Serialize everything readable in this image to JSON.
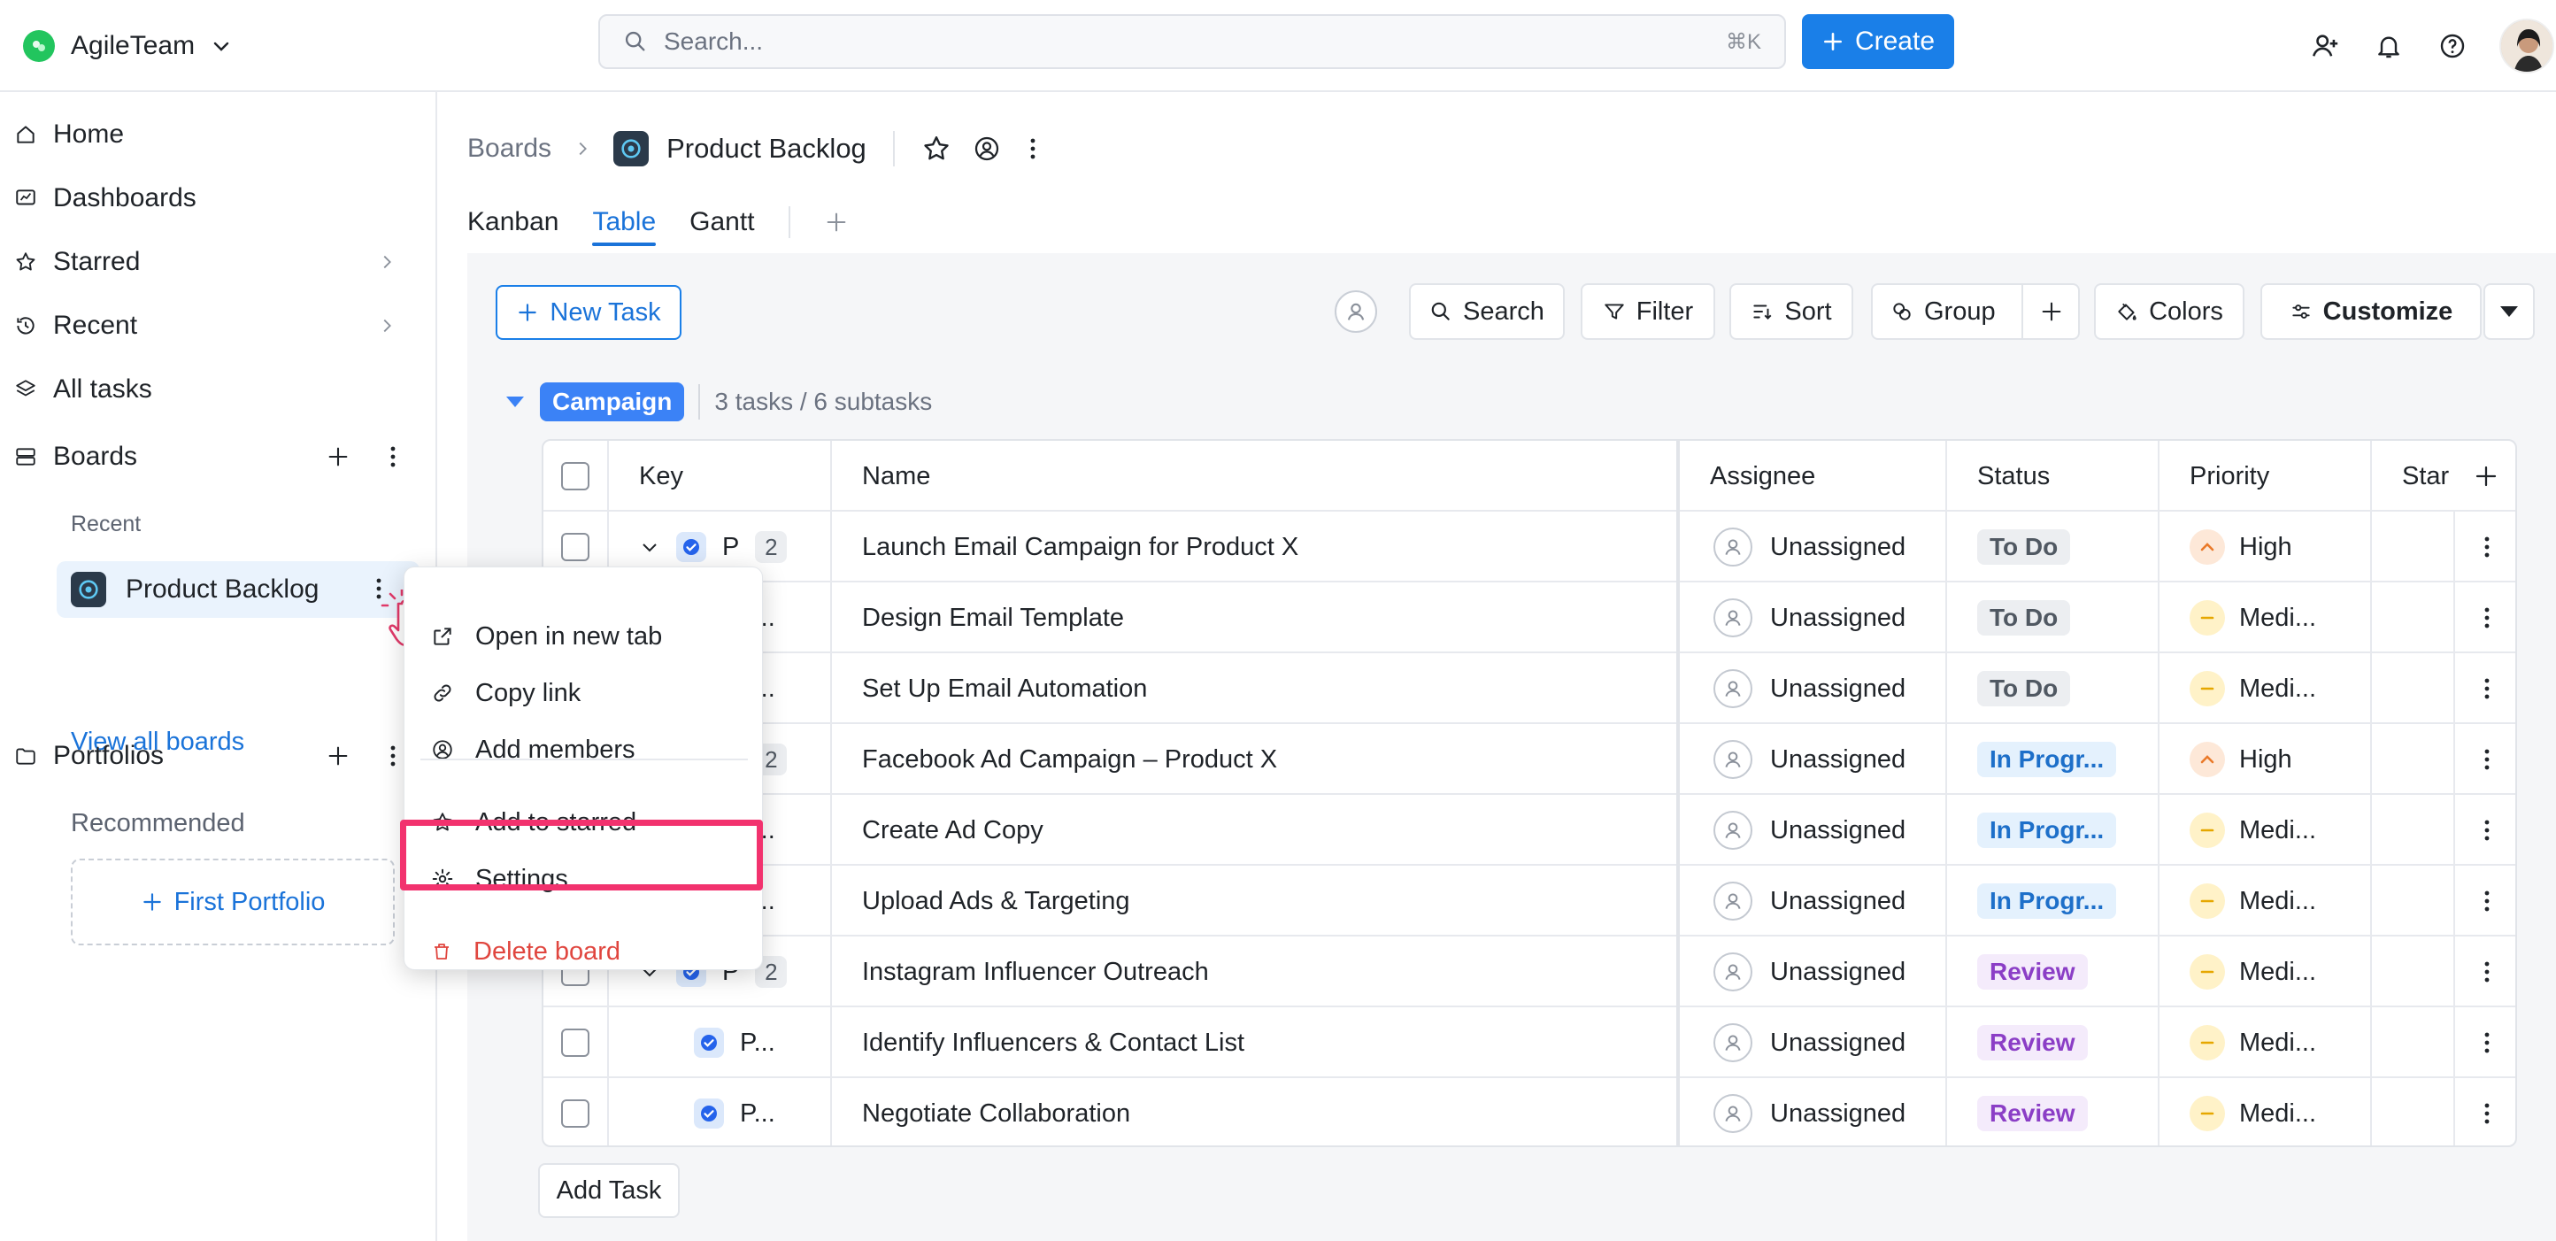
{
  "colors": {
    "accent": "#1a7fe8",
    "brand": "#22c55e",
    "highlight": "#f2326e",
    "danger": "#e0463f"
  },
  "topbar": {
    "workspace": "AgileTeam",
    "search_placeholder": "Search...",
    "search_shortcut": "⌘K",
    "create_label": "Create"
  },
  "sidebar": {
    "home": "Home",
    "dashboards": "Dashboards",
    "starred": "Starred",
    "recent": "Recent",
    "all_tasks": "All tasks",
    "boards": "Boards",
    "boards_recent": "Recent",
    "board_item": "Product Backlog",
    "view_all": "View all boards",
    "portfolios": "Portfolios",
    "recommended": "Recommended",
    "first_portfolio": "First Portfolio"
  },
  "header": {
    "crumb_root": "Boards",
    "board_title": "Product Backlog",
    "tabs": [
      "Kanban",
      "Table",
      "Gantt"
    ],
    "active_tab": "Table"
  },
  "toolbar": {
    "new_task": "New Task",
    "search": "Search",
    "filter": "Filter",
    "sort": "Sort",
    "group": "Group",
    "colors": "Colors",
    "customize": "Customize"
  },
  "group": {
    "name": "Campaign",
    "count": "3 tasks / 6 subtasks"
  },
  "table": {
    "columns": [
      "Key",
      "Name",
      "Assignee",
      "Status",
      "Priority",
      "Star"
    ],
    "rows": [
      {
        "key": "P",
        "sub": "2",
        "name": "Launch Email Campaign for Product X",
        "assignee": "Unassigned",
        "status": "To Do",
        "status_type": "todo",
        "priority": "High",
        "priority_type": "high"
      },
      {
        "key": "P...",
        "name": "Design Email Template",
        "assignee": "Unassigned",
        "status": "To Do",
        "status_type": "todo",
        "priority": "Medi...",
        "priority_type": "med"
      },
      {
        "key": "P...",
        "name": "Set Up Email Automation",
        "assignee": "Unassigned",
        "status": "To Do",
        "status_type": "todo",
        "priority": "Medi...",
        "priority_type": "med"
      },
      {
        "key": "P",
        "sub": "2",
        "name": "Facebook Ad Campaign – Product X",
        "assignee": "Unassigned",
        "status": "In Progr...",
        "status_type": "prog",
        "priority": "High",
        "priority_type": "high"
      },
      {
        "key": "P...",
        "name": "Create Ad Copy",
        "assignee": "Unassigned",
        "status": "In Progr...",
        "status_type": "prog",
        "priority": "Medi...",
        "priority_type": "med"
      },
      {
        "key": "P...",
        "name": "Upload Ads & Targeting",
        "assignee": "Unassigned",
        "status": "In Progr...",
        "status_type": "prog",
        "priority": "Medi...",
        "priority_type": "med"
      },
      {
        "key": "P",
        "sub": "2",
        "name": "Instagram Influencer Outreach",
        "assignee": "Unassigned",
        "status": "Review",
        "status_type": "review",
        "priority": "Medi...",
        "priority_type": "med"
      },
      {
        "key": "P...",
        "name": "Identify Influencers & Contact List",
        "assignee": "Unassigned",
        "status": "Review",
        "status_type": "review",
        "priority": "Medi...",
        "priority_type": "med"
      },
      {
        "key": "P...",
        "name": "Negotiate Collaboration",
        "assignee": "Unassigned",
        "status": "Review",
        "status_type": "review",
        "priority": "Medi...",
        "priority_type": "med"
      }
    ],
    "add_task": "Add Task"
  },
  "context_menu": {
    "open_new_tab": "Open in new tab",
    "copy_link": "Copy link",
    "add_members": "Add members",
    "add_starred": "Add to starred",
    "settings": "Settings",
    "delete_board": "Delete board"
  }
}
